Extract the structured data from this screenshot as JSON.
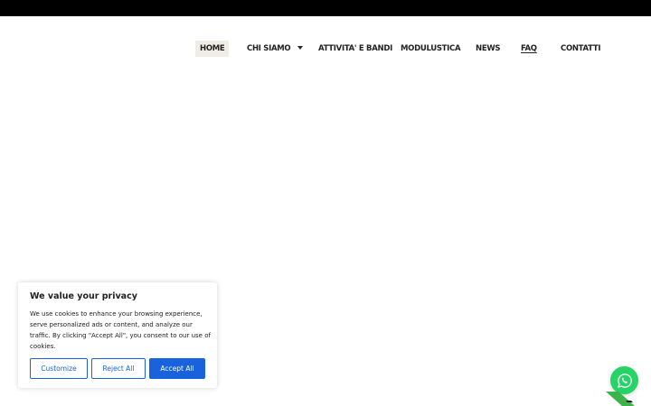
{
  "nav": {
    "items": [
      {
        "label": "HOME"
      },
      {
        "label": "CHI SIAMO"
      },
      {
        "label": "ATTIVITA' E BANDI"
      },
      {
        "label": "MODULUSTICA"
      },
      {
        "label": "NEWS"
      },
      {
        "label": "FAQ"
      },
      {
        "label": "CONTATTI"
      }
    ]
  },
  "cookie": {
    "title": "We value your privacy",
    "text": "We use cookies to enhance your browsing experience, serve personalized ads or content, and analyze our traffic. By clicking \"Accept All\", you consent to our use of cookies.",
    "customize_label": "Customize",
    "reject_label": "Reject All",
    "accept_label": "Accept All"
  },
  "colors": {
    "accent": "#1863dc",
    "whatsapp": "#25d366",
    "topbar": "#000000",
    "active_nav_bg": "#f2ece6"
  },
  "icons": {
    "floating_button": "whatsapp-icon",
    "dropdown": "caret-down-icon"
  }
}
